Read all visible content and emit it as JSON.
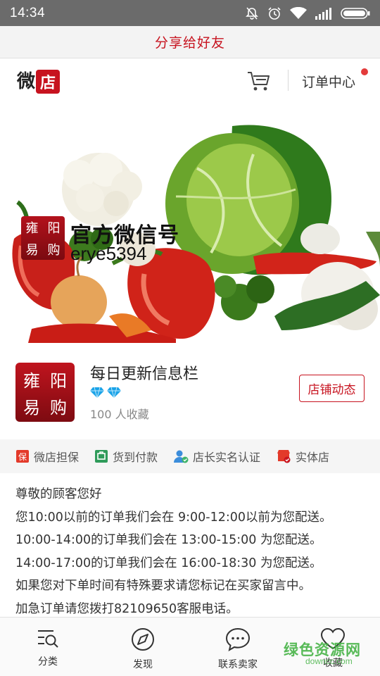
{
  "status_bar": {
    "time": "14:34",
    "icons": [
      "mute-icon",
      "alarm-icon",
      "wifi-icon",
      "signal-icon",
      "battery-icon"
    ]
  },
  "share": {
    "label": "分享给好友"
  },
  "header": {
    "logo_wei": "微",
    "logo_dian": "店",
    "order_center": "订单中心",
    "has_notification": true
  },
  "banner": {
    "badge_chars": [
      "雍",
      "阳",
      "易",
      "购"
    ],
    "title": "官方微信号",
    "wechat_id": "erye5394"
  },
  "shop": {
    "avatar_chars": [
      "雍",
      "阳",
      "易",
      "购"
    ],
    "name": "每日更新信息栏",
    "diamond_count": 2,
    "favorites": "100 人收藏",
    "news_button": "店铺动态"
  },
  "guarantees": [
    {
      "icon": "shield-icon",
      "label": "微店担保"
    },
    {
      "icon": "cod-icon",
      "label": "货到付款"
    },
    {
      "icon": "verified-user-icon",
      "label": "店长实名认证"
    },
    {
      "icon": "store-icon",
      "label": "实体店"
    }
  ],
  "notice": [
    "尊敬的顾客您好",
    "您10:00以前的订单我们会在 9:00-12:00以前为您配送。",
    "10:00-14:00的订单我们会在 13:00-15:00 为您配送。",
    "14:00-17:00的订单我们会在 16:00-18:30 为您配送。",
    "如果您对下单时间有特殊要求请您标记在买家留言中。",
    "加急订单请您拨打82109650客服电话。"
  ],
  "bottom_nav": [
    {
      "icon": "category-icon",
      "label": "分类"
    },
    {
      "icon": "discover-icon",
      "label": "发现"
    },
    {
      "icon": "chat-icon",
      "label": "联系卖家"
    },
    {
      "icon": "heart-icon",
      "label": "收藏"
    }
  ],
  "watermark": {
    "text": "绿色资源网",
    "sub": "downcc.com"
  },
  "colors": {
    "accent": "#c7131f",
    "status_bar": "#6b6b6b"
  }
}
